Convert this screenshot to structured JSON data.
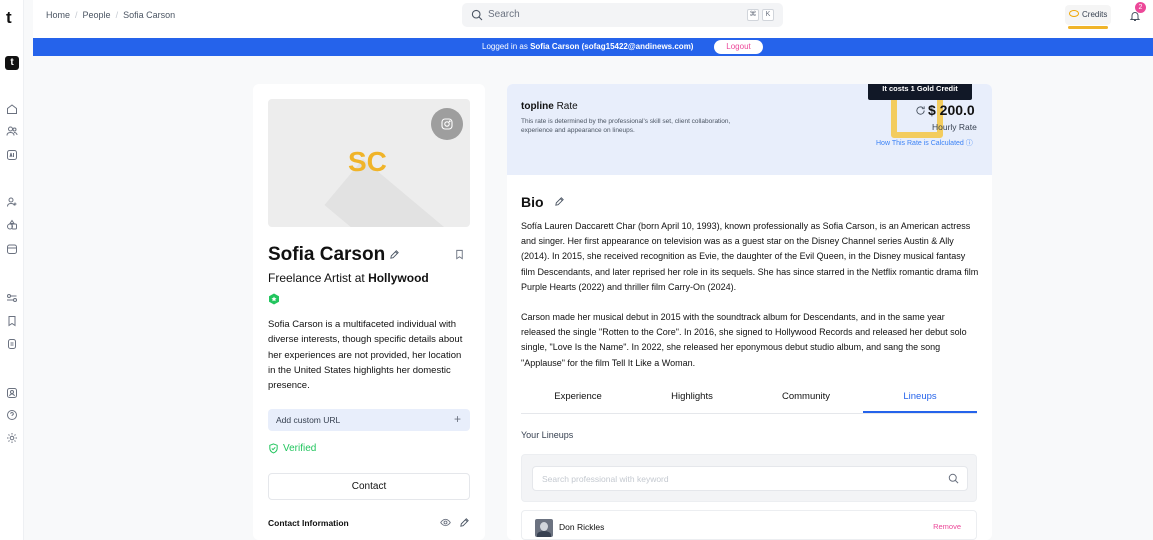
{
  "app": {
    "logo_letter": "t",
    "logo_box_letter": "t"
  },
  "nav": {
    "breadcrumb": [
      "Home",
      "People",
      "Sofia Carson"
    ],
    "search_placeholder": "Search",
    "kbd_keys": [
      "⌘",
      "K"
    ],
    "credits_label": "Credits",
    "notifications_count": "2"
  },
  "banner": {
    "message_prefix": "Logged in as",
    "user": "Sofia Carson (sofag15422@andinews.com)",
    "logout_label": "Logout"
  },
  "profile": {
    "initials": "SC",
    "name": "Sofia Carson",
    "role_prefix": "Freelance Artist at",
    "company": "Hollywood",
    "about": "Sofia Carson is a multifaceted individual with diverse interests, though specific details about her experiences are not provided, her location in the United States highlights her domestic presence.",
    "custom_url_label": "Add custom URL",
    "custom_url_plus": "+",
    "verified_label": "Verified",
    "contact_button": "Contact",
    "contact_info_label": "Contact Information"
  },
  "rate": {
    "brand": "topline",
    "title_suffix": "Rate",
    "description": "This rate is determined by the professional's skill set, client collaboration, experience and appearance on lineups.",
    "tooltip": "It costs 1 Gold Credit",
    "amount": "$ 200.0",
    "unit": "Hourly Rate",
    "link": "How This Rate is Calculated"
  },
  "bio": {
    "heading": "Bio",
    "paragraphs": [
      "Sofía Lauren Daccarett Char (born April 10, 1993), known professionally as Sofia Carson, is an American actress and singer. Her first appearance on television was as a guest star on the Disney Channel series Austin & Ally (2014). In 2015, she received recognition as Evie, the daughter of the Evil Queen, in the Disney musical fantasy film Descendants, and later reprised her role in its sequels. She has since starred in the Netflix romantic drama film Purple Hearts (2022) and thriller film Carry-On (2024).",
      "Carson made her musical debut in 2015 with the soundtrack album for Descendants, and in the same year released the single \"Rotten to the Core\". In 2016, she signed to Hollywood Records and released her debut solo single, \"Love Is the Name\". In 2022, she released her eponymous debut studio album, and sang the song \"Applause\" for the film Tell It Like a Woman."
    ]
  },
  "tabs": [
    {
      "label": "Experience",
      "active": false
    },
    {
      "label": "Highlights",
      "active": false
    },
    {
      "label": "Community",
      "active": false
    },
    {
      "label": "Lineups",
      "active": true
    }
  ],
  "lineups": {
    "heading": "Your Lineups",
    "search_placeholder": "Search professional with keyword",
    "items": [
      {
        "name": "Don Rickles",
        "action": "Remove"
      }
    ]
  },
  "colors": {
    "accent": "#2563eb",
    "gold": "#f0b429",
    "pink": "#ec4899",
    "verified": "#22c55e"
  }
}
